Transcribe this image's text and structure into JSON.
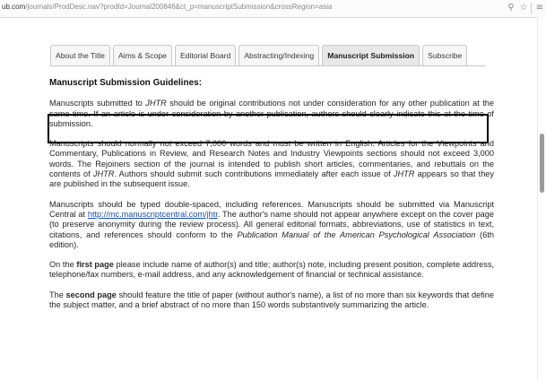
{
  "browser": {
    "url_domain": "ub.com",
    "url_path": "/journals/ProdDesc.nav?prodId=Journal200846&ct_p=manuscriptSubmission&crossRegion=asia",
    "icons": [
      "search-icon",
      "star-icon",
      "menu-icon"
    ]
  },
  "tabs": [
    {
      "label": "About the Title"
    },
    {
      "label": "Aims & Scope"
    },
    {
      "label": "Editorial Board"
    },
    {
      "label": "Abstracting/Indexing"
    },
    {
      "label": "Manuscript Submission",
      "active": true
    },
    {
      "label": "Subscribe"
    }
  ],
  "content": {
    "heading": "Manuscript Submission Guidelines:",
    "p1": {
      "a": "Manuscripts submitted to ",
      "journal": "JHTR",
      "b": " should be original contributions not under consideration for any other publication at the same time. If an article is under consideration by another publication, authors should clearly indicate this at the time of submission."
    },
    "p2": {
      "a": "Manuscripts should normally not exceed 7,000 words and must be written in English. Articles for the Viewpoints and Commentary, Publications in Review, and Research Notes and Industry Viewpoints sections should not exceed 3,000 words. The Rejoiners section of the journal is intended to publish short articles, commentaries, and rebuttals on the contents of ",
      "journal1": "JHTR",
      "b": ". Authors should submit such contributions immediately after each issue of ",
      "journal2": "JHTR",
      "c": " appears so that they are published in the subsequent issue."
    },
    "p3": {
      "a": "Manuscripts should be typed double-spaced, including references. Manuscripts should be submitted via Manuscript Central at ",
      "link": "http://mc.manuscriptcentral.com/jhtr",
      "b": ". The author's name should not appear anywhere except on the cover page (to preserve anonymity during the review process). All general editorial formats, abbreviations, use of statistics in text, citations, and references should conform to the ",
      "manual": "Publication Manual of the American Psychological Association",
      "c": " (6th edition)."
    },
    "p4": {
      "a": "On the ",
      "bold": "first page",
      "b": " please include name of author(s) and title; author(s) note, including present position, complete address, telephone/fax numbers, e-mail address, and any acknowledgement of financial or technical assistance."
    },
    "p5": {
      "a": "The ",
      "bold": "second page",
      "b": " should feature the title of paper (without author's name), a list of no more than six keywords that define the subject matter, and a brief abstract of no more than 150 words substantively summarizing the article."
    }
  }
}
